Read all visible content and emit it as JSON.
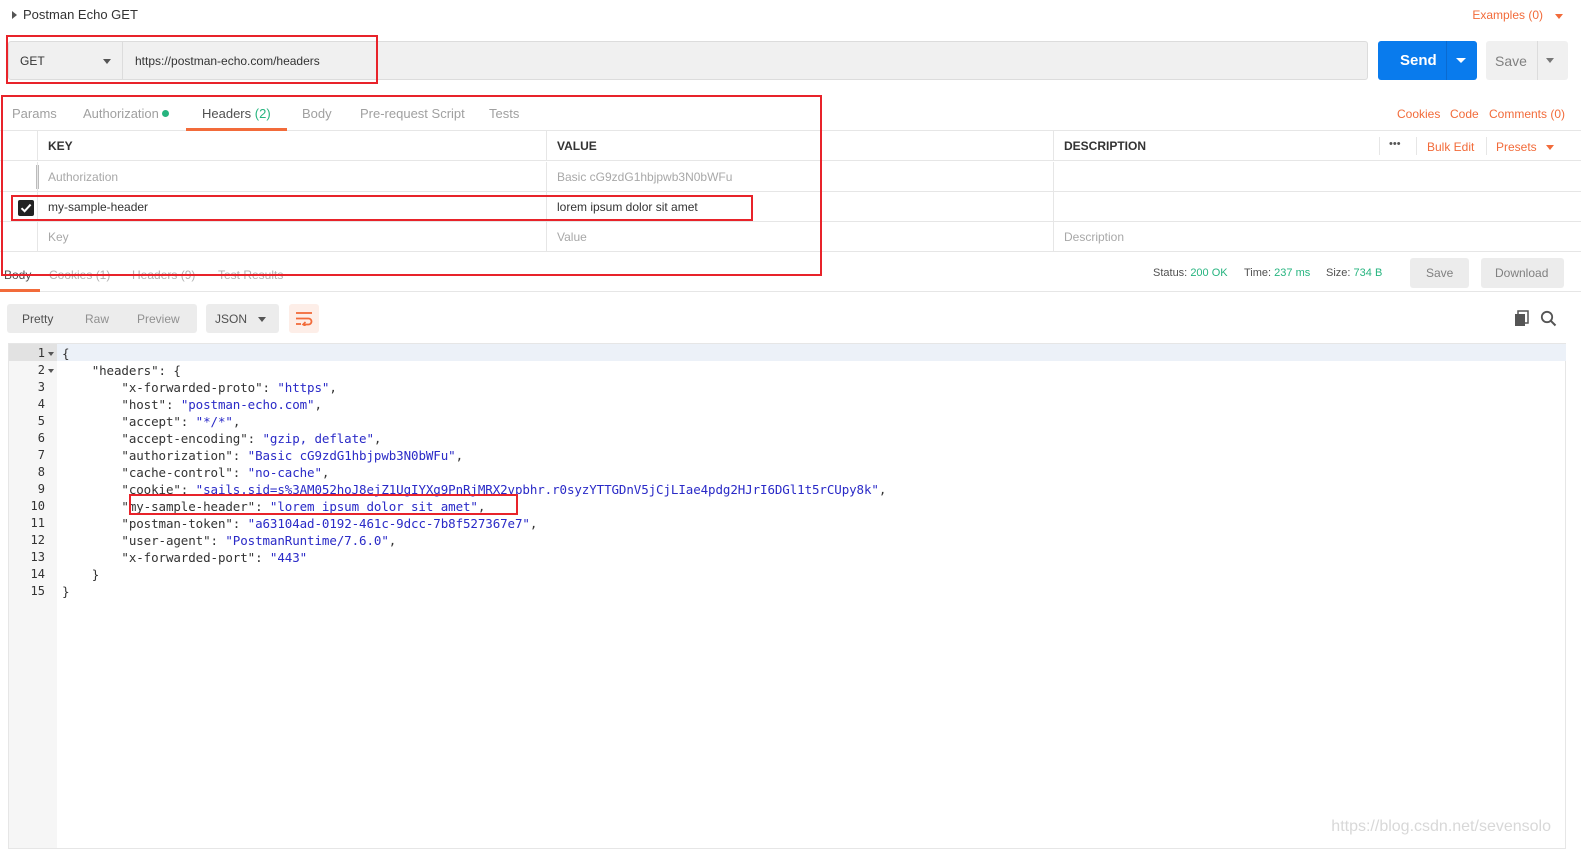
{
  "request": {
    "title": "Postman Echo GET",
    "examples_label": "Examples (0)",
    "method": "GET",
    "url": "https://postman-echo.com/headers",
    "send_label": "Send",
    "save_label": "Save"
  },
  "request_tabs": [
    {
      "label": "Params",
      "count": ""
    },
    {
      "label": "Authorization",
      "count": ""
    },
    {
      "label": "Headers",
      "count": "(2)"
    },
    {
      "label": "Body",
      "count": ""
    },
    {
      "label": "Pre-request Script",
      "count": ""
    },
    {
      "label": "Tests",
      "count": ""
    }
  ],
  "right_links": {
    "cookies": "Cookies",
    "code": "Code",
    "comments": "Comments (0)"
  },
  "headers_table": {
    "col_key": "KEY",
    "col_value": "VALUE",
    "col_description": "DESCRIPTION",
    "more": "•••",
    "bulk_edit": "Bulk Edit",
    "presets": "Presets",
    "rows": [
      {
        "key": "Authorization",
        "value": "Basic cG9zdG1hbjpwb3N0bWFu",
        "enabled": false
      },
      {
        "key": "my-sample-header",
        "value": "lorem ipsum dolor sit amet",
        "enabled": true
      }
    ],
    "placeholder_key": "Key",
    "placeholder_value": "Value",
    "placeholder_description": "Description"
  },
  "response_tabs": [
    {
      "label": "Body"
    },
    {
      "label": "Cookies (1)"
    },
    {
      "label": "Headers (9)"
    },
    {
      "label": "Test Results"
    }
  ],
  "response_meta": {
    "status_label": "Status:",
    "status_value": "200 OK",
    "time_label": "Time:",
    "time_value": "237 ms",
    "size_label": "Size:",
    "size_value": "734 B",
    "save_label": "Save",
    "download_label": "Download"
  },
  "view_modes": [
    "Pretty",
    "Raw",
    "Preview"
  ],
  "active_view": "Pretty",
  "format": "JSON",
  "code_lines": [
    {
      "n": "1",
      "text": "{"
    },
    {
      "n": "2",
      "text": "    \"headers\": {"
    },
    {
      "n": "3",
      "text": "        \"x-forwarded-proto\": \"https\","
    },
    {
      "n": "4",
      "text": "        \"host\": \"postman-echo.com\","
    },
    {
      "n": "5",
      "text": "        \"accept\": \"*/*\","
    },
    {
      "n": "6",
      "text": "        \"accept-encoding\": \"gzip, deflate\","
    },
    {
      "n": "7",
      "text": "        \"authorization\": \"Basic cG9zdG1hbjpwb3N0bWFu\","
    },
    {
      "n": "8",
      "text": "        \"cache-control\": \"no-cache\","
    },
    {
      "n": "9",
      "text": "        \"cookie\": \"sails.sid=s%3AM052hoJ8ejZ1UgIYXg9PnRjMRX2vpbhr.r0syzYTTGDnV5jCjLIae4pdg2HJrI6DGl1t5rCUpy8k\","
    },
    {
      "n": "10",
      "text": "        \"my-sample-header\": \"lorem ipsum dolor sit amet\","
    },
    {
      "n": "11",
      "text": "        \"postman-token\": \"a63104ad-0192-461c-9dcc-7b8f527367e7\","
    },
    {
      "n": "12",
      "text": "        \"user-agent\": \"PostmanRuntime/7.6.0\","
    },
    {
      "n": "13",
      "text": "        \"x-forwarded-port\": \"443\""
    },
    {
      "n": "14",
      "text": "    }"
    },
    {
      "n": "15",
      "text": "}"
    }
  ],
  "watermark": "https://blog.csdn.net/sevensolo",
  "colors": {
    "accent": "#f26b3a",
    "send": "#097bed",
    "success": "#26b47f",
    "highlight_box": "#e8232a",
    "json_string": "#2a2ac7"
  }
}
